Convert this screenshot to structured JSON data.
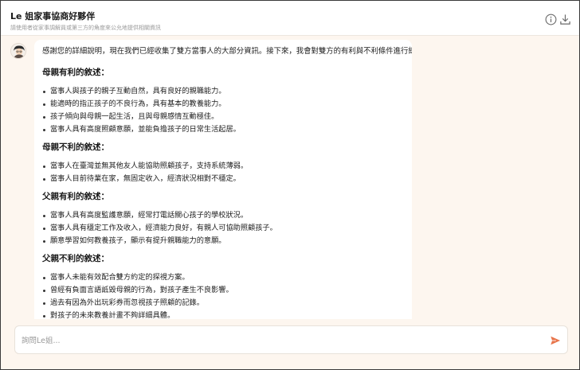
{
  "header": {
    "title": "Le 姐家事協商好夥伴",
    "subtitle": "請使用者從家事調解員或第三方的角度來公允地提供相關資訊"
  },
  "message": {
    "intro": "感謝您的詳細說明，現在我們已經收集了雙方當事人的大部分資訊。接下來，我會對雙方的有利與不利條件進行總結：",
    "sections": [
      {
        "title": "母親有利的敘述：",
        "items": [
          "當事人與孩子的親子互動自然，具有良好的親職能力。",
          "能適時的指正孩子的不良行為，具有基本的教養能力。",
          "孩子傾向與母親一起生活，且與母親感情互動極佳。",
          "當事人具有高度照顧意願，並能負擔孩子的日常生活起居。"
        ]
      },
      {
        "title": "母親不利的敘述：",
        "items": [
          "當事人在臺灣並無其他友人能協助照顧孩子，支持系統薄弱。",
          "當事人目前待業在家，無固定收入，經濟狀況相對不穩定。"
        ]
      },
      {
        "title": "父親有利的敘述：",
        "items": [
          "當事人具有高度監護意願，經常打電話關心孩子的學校狀況。",
          "當事人具有穩定工作及收入，經濟能力良好，有親人可協助照顧孩子。",
          "願意學習如何教養孩子，顯示有提升親職能力的意願。"
        ]
      },
      {
        "title": "父親不利的敘述：",
        "items": [
          "當事人未能有效配合雙方約定的探視方案。",
          "曾經有負面言語詆毀母親的行為，對孩子產生不良影響。",
          "過去有因為外出玩彩券而忽視孩子照顧的記錄。",
          "對孩子的未來教養計畫不夠詳細具體。"
        ]
      }
    ]
  },
  "composer": {
    "placeholder": "詢問Le姐..."
  },
  "icons": {
    "info": "info-icon",
    "download": "download-icon",
    "send": "send-icon",
    "avatar": "avatar"
  },
  "colors": {
    "background": "#fdf6ef",
    "send": "#e8744a"
  }
}
